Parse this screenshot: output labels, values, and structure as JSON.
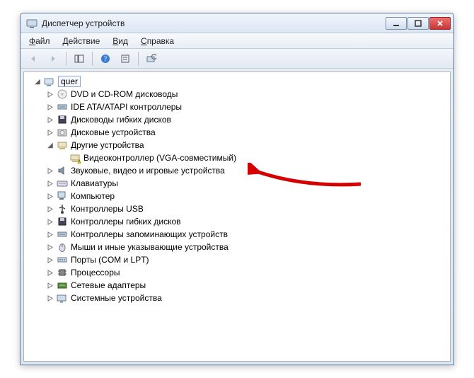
{
  "title": "Диспетчер устройств",
  "menus": {
    "file": {
      "label": "Файл",
      "underline": 0
    },
    "action": {
      "label": "Действие",
      "underline": 0
    },
    "view": {
      "label": "Вид",
      "underline": 0
    },
    "help": {
      "label": "Справка",
      "underline": 0
    }
  },
  "root": {
    "label": "quer"
  },
  "categories": [
    {
      "id": "dvd",
      "label": "DVD и CD-ROM дисководы"
    },
    {
      "id": "ide",
      "label": "IDE ATA/ATAPI контроллеры"
    },
    {
      "id": "floppy",
      "label": "Дисководы гибких дисков"
    },
    {
      "id": "disk",
      "label": "Дисковые устройства"
    },
    {
      "id": "other",
      "label": "Другие устройства",
      "expanded": true,
      "children": [
        {
          "id": "vga",
          "label": "Видеоконтроллер (VGA-совместимый)",
          "warn": true
        }
      ]
    },
    {
      "id": "sound",
      "label": "Звуковые, видео и игровые устройства"
    },
    {
      "id": "keyboard",
      "label": "Клавиатуры"
    },
    {
      "id": "computer",
      "label": "Компьютер"
    },
    {
      "id": "usb",
      "label": "Контроллеры USB"
    },
    {
      "id": "floppyctrl",
      "label": "Контроллеры гибких дисков"
    },
    {
      "id": "storage",
      "label": "Контроллеры запоминающих устройств"
    },
    {
      "id": "mouse",
      "label": "Мыши и иные указывающие устройства"
    },
    {
      "id": "ports",
      "label": "Порты (COM и LPT)"
    },
    {
      "id": "cpu",
      "label": "Процессоры"
    },
    {
      "id": "net",
      "label": "Сетевые адаптеры"
    },
    {
      "id": "system",
      "label": "Системные устройства"
    }
  ]
}
